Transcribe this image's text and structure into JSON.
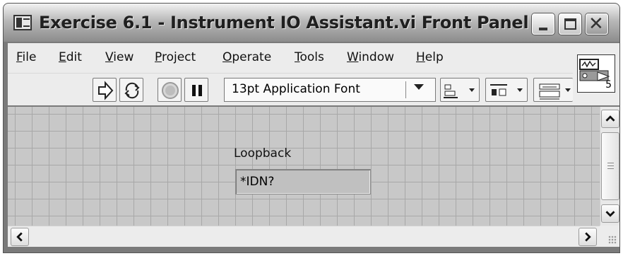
{
  "window": {
    "title": "Exercise 6.1 - Instrument IO Assistant.vi Front Panel"
  },
  "menu": {
    "items": [
      {
        "label": "File",
        "accel": "F",
        "rest": "ile"
      },
      {
        "label": "Edit",
        "accel": "E",
        "rest": "dit"
      },
      {
        "label": "View",
        "accel": "V",
        "rest": "iew"
      },
      {
        "label": "Project",
        "accel": "P",
        "rest": "roject"
      },
      {
        "label": "Operate",
        "accel": "O",
        "rest": "perate"
      },
      {
        "label": "Tools",
        "accel": "T",
        "rest": "ools"
      },
      {
        "label": "Window",
        "accel": "W",
        "rest": "indow"
      },
      {
        "label": "Help",
        "accel": "H",
        "rest": "elp"
      }
    ]
  },
  "toolbar": {
    "font_select_value": "13pt Application Font",
    "icons": [
      "run-arrow-icon",
      "run-continuously-icon",
      "abort-icon",
      "pause-icon",
      "align-objects-icon",
      "distribute-objects-icon",
      "resize-objects-icon"
    ]
  },
  "vi_icon": {
    "number": "5"
  },
  "panel": {
    "control_label": "Loopback",
    "control_value": "*IDN?"
  },
  "colors": {
    "panel_bg": "#c8c8c8",
    "grid_line": "#a8a8a8",
    "toolbar_bg": "#ececec"
  }
}
